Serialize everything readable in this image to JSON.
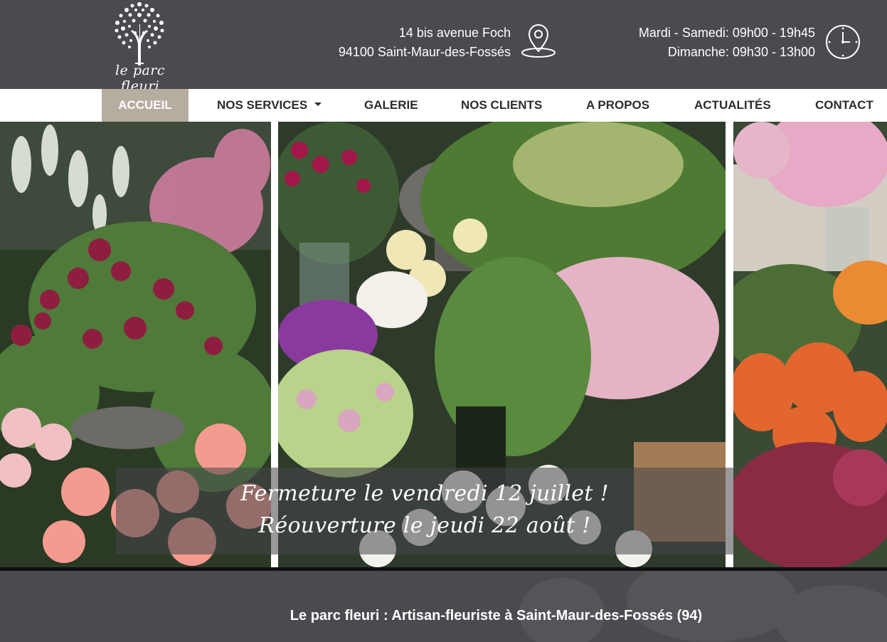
{
  "brand": {
    "logo_text": "le parc fleuri"
  },
  "contact": {
    "address_line1": "14 bis avenue Foch",
    "address_line2": "94100 Saint-Maur-des-Fossés",
    "hours_line1": "Mardi - Samedi: 09h00 - 19h45",
    "hours_line2": "Dimanche: 09h30 - 13h00"
  },
  "nav": {
    "items": [
      {
        "label": "ACCUEIL",
        "active": true
      },
      {
        "label": "NOS SERVICES",
        "dropdown": true
      },
      {
        "label": "GALERIE"
      },
      {
        "label": "NOS CLIENTS"
      },
      {
        "label": "A PROPOS"
      },
      {
        "label": "ACTUALITÉS"
      },
      {
        "label": "CONTACT"
      }
    ]
  },
  "hero": {
    "banner_line1": "Fermeture le vendredi 12 juillet !",
    "banner_line2": "Réouverture le jeudi 22 août !"
  },
  "intro": {
    "title": "Le parc fleuri : Artisan-fleuriste à Saint-Maur-des-Fossés (94)"
  },
  "colors": {
    "header_bg": "#4a4a50",
    "nav_active_bg": "#b6ada1",
    "nav_text": "#2d2d2d",
    "band_bg": "#4b4a4e"
  },
  "icons": [
    "tree-logo-icon",
    "map-pin-icon",
    "clock-icon",
    "chevron-down-icon"
  ]
}
